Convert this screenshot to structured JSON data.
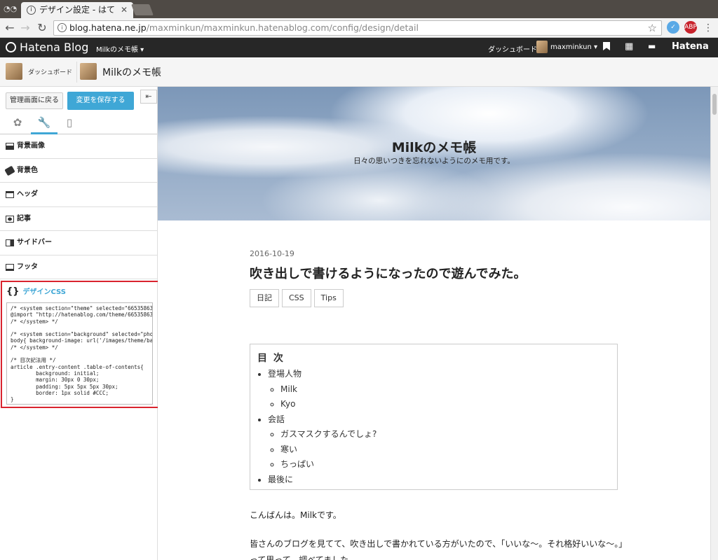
{
  "browser": {
    "tab_title": "デザイン設定 - はて",
    "url_host": "blog.hatena.ne.jp",
    "url_path": "/maxminkun/maxminkun.hatenablog.com/config/design/detail",
    "extensions": [
      "extension-blue",
      "extension-abp"
    ]
  },
  "hatena_bar": {
    "logo": "Hatena Blog",
    "blog_menu": "Milkのメモ帳 ▾",
    "dashboard": "ダッシュボード",
    "user": "maxminkun ▾",
    "brand": "Hatena"
  },
  "blog_header": {
    "dashboard": "ダッシュボード",
    "blog_name": "Milkのメモ帳"
  },
  "sidebar": {
    "back_button": "管理画面に戻る",
    "save_button": "変更を保存する",
    "collapse": "⇤",
    "tabs": [
      "palette-icon",
      "wrench-icon",
      "mobile-icon"
    ],
    "items": [
      {
        "label": "背景画像",
        "icon": "image-icon"
      },
      {
        "label": "背景色",
        "icon": "paint-bucket-icon"
      },
      {
        "label": "ヘッダ",
        "icon": "header-icon"
      },
      {
        "label": "記事",
        "icon": "article-icon"
      },
      {
        "label": "サイドバー",
        "icon": "sidebar-icon"
      },
      {
        "label": "フッタ",
        "icon": "footer-icon"
      }
    ],
    "css_title": "デザインCSS",
    "css_brace": "{}",
    "css_code": "/* <system section=\"theme\" selected=\"665358634\n@import \"http://hatenablog.com/theme/665358634\n/* </system> */\n\n/* <system section=\"background\" selected=\"phot\nbody{ background-image: url('/images/theme/bac\n/* </system> */\n\n/* 目次記法用 */\narticle .entry-content .table-of-contents{\n        background: initial;\n        margin: 30px 0 30px;\n        padding: 5px 5px 5px 30px;\n        border: 1px solid #CCC;\n}"
  },
  "preview": {
    "blog_title": "Milkのメモ帳",
    "blog_subtitle": "日々の思いつきを忘れないようにのメモ用です。",
    "post_date": "2016-10-19",
    "post_title": "吹き出しで書けるようになったので遊んでみた。",
    "tags": [
      "日記",
      "CSS",
      "Tips"
    ],
    "toc_title": "目 次",
    "toc": [
      {
        "label": "登場人物",
        "children": [
          "Milk",
          "Kyo"
        ]
      },
      {
        "label": "会話",
        "children": [
          "ガスマスクするんでしょ?",
          "寒い",
          "ちっぱい"
        ]
      },
      {
        "label": "最後に",
        "children": []
      }
    ],
    "paragraph1": "こんばんは。Milkです。",
    "paragraph2": "皆さんのブログを見てて、吹き出しで書かれている方がいたので、「いいな〜。それ格好いいな〜。」",
    "paragraph3": "って思って、調べてました。"
  }
}
